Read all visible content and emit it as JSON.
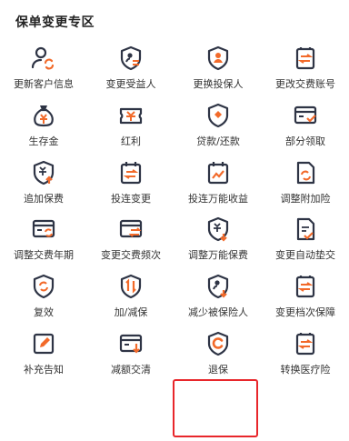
{
  "section": {
    "title": "保单变更专区"
  },
  "colors": {
    "primary": "#2e3445",
    "accent": "#f26a2a",
    "highlight": "#e8262b"
  },
  "items": [
    {
      "label": "更新客户信息",
      "icon": "user-refresh-icon"
    },
    {
      "label": "变更受益人",
      "icon": "shield-user-swap-icon"
    },
    {
      "label": "更换投保人",
      "icon": "shield-person-icon"
    },
    {
      "label": "更改交费账号",
      "icon": "document-swap-icon"
    },
    {
      "label": "生存金",
      "icon": "money-bag-icon"
    },
    {
      "label": "红利",
      "icon": "yen-ticket-icon"
    },
    {
      "label": "贷款/还款",
      "icon": "shield-coin-icon"
    },
    {
      "label": "部分领取",
      "icon": "card-check-icon"
    },
    {
      "label": "追加保费",
      "icon": "shield-yen-up-icon"
    },
    {
      "label": "投连变更",
      "icon": "calendar-swap-icon"
    },
    {
      "label": "投连万能收益",
      "icon": "calendar-chart-icon"
    },
    {
      "label": "调整附加险",
      "icon": "document-refresh-icon"
    },
    {
      "label": "调整交费年期",
      "icon": "card-refresh-icon"
    },
    {
      "label": "变更交费频次",
      "icon": "card-swap-icon"
    },
    {
      "label": "调整万能保费",
      "icon": "shield-yen-down-icon"
    },
    {
      "label": "变更自动垫交",
      "icon": "document-check-icon"
    },
    {
      "label": "复效",
      "icon": "shield-refresh-icon"
    },
    {
      "label": "加/减保",
      "icon": "shield-updown-icon"
    },
    {
      "label": "减少被保险人",
      "icon": "shield-person-down-icon"
    },
    {
      "label": "变更档次保障",
      "icon": "document-swap-icon"
    },
    {
      "label": "补充告知",
      "icon": "edit-note-icon"
    },
    {
      "label": "减额交清",
      "icon": "card-down-icon"
    },
    {
      "label": "退保",
      "icon": "shield-c-icon",
      "selected": true
    },
    {
      "label": "转换医疗险",
      "icon": "document-swap-icon"
    }
  ]
}
